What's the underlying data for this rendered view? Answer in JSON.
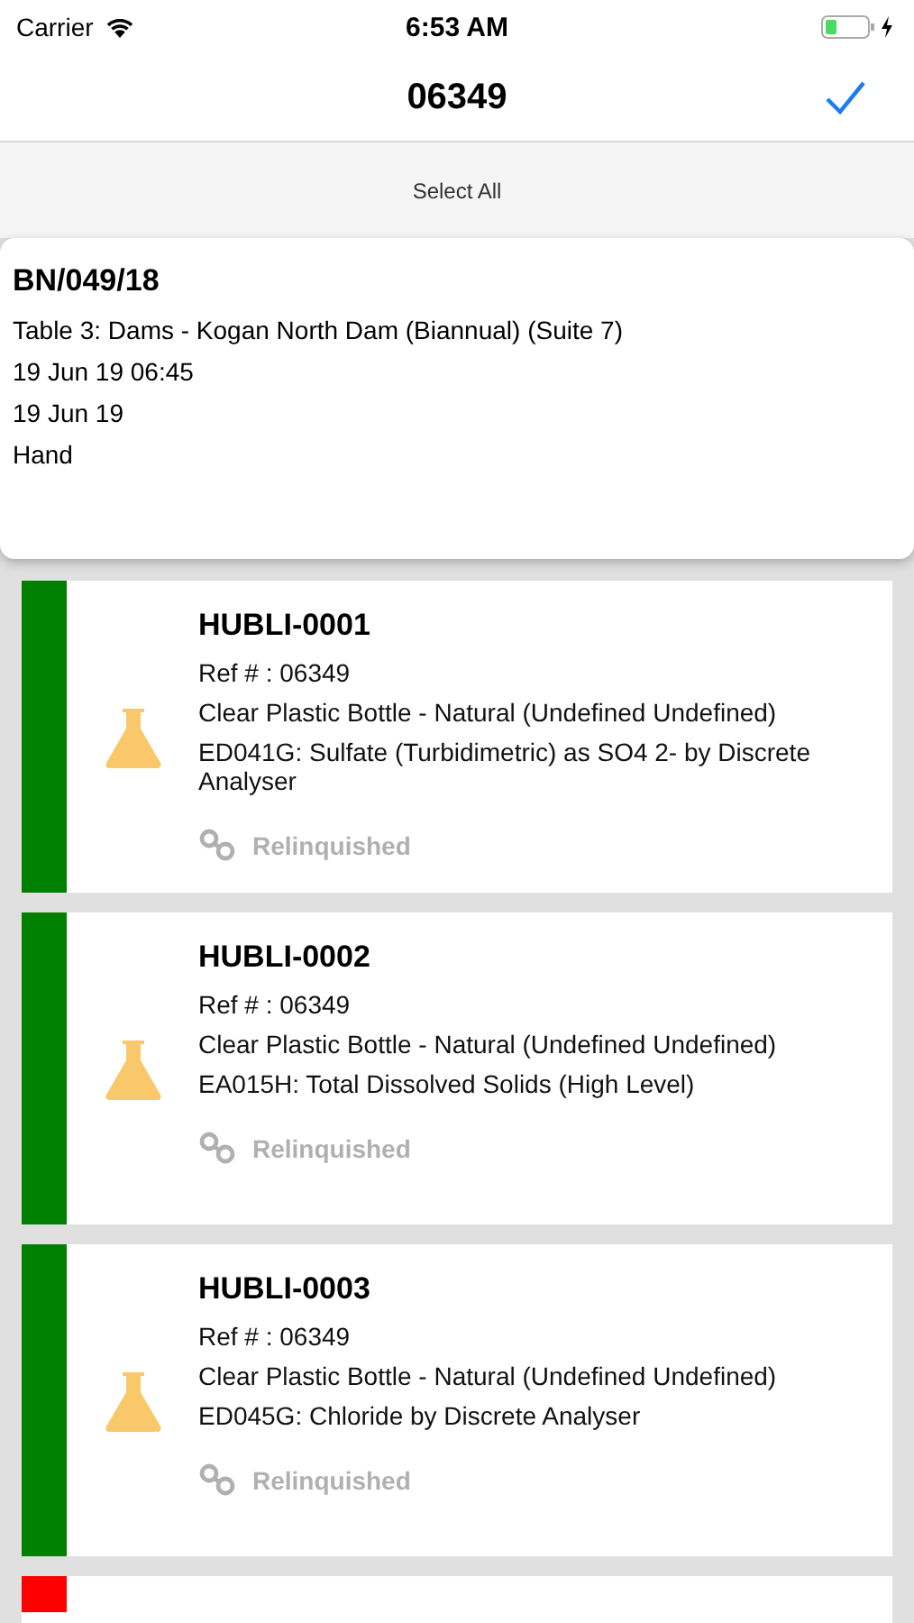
{
  "status_bar": {
    "carrier": "Carrier",
    "time": "6:53 AM"
  },
  "nav": {
    "title": "06349"
  },
  "select_all": "Select All",
  "header": {
    "batch": "BN/049/18",
    "lines": [
      "Table 3: Dams - Kogan North Dam (Biannual) (Suite 7)",
      "19 Jun 19 06:45",
      "19 Jun 19",
      "Hand"
    ]
  },
  "samples": [
    {
      "id": "HUBLI-0001",
      "ref": "Ref # : 06349",
      "container": "Clear Plastic Bottle - Natural (Undefined Undefined)",
      "test": "ED041G: Sulfate (Turbidimetric) as SO4 2- by Discrete Analyser",
      "status": "Relinquished",
      "color": "#008000"
    },
    {
      "id": "HUBLI-0002",
      "ref": "Ref # : 06349",
      "container": "Clear Plastic Bottle - Natural (Undefined Undefined)",
      "test": "EA015H: Total Dissolved Solids (High Level)",
      "status": "Relinquished",
      "color": "#008000"
    },
    {
      "id": "HUBLI-0003",
      "ref": "Ref # : 06349",
      "container": "Clear Plastic Bottle - Natural (Undefined Undefined)",
      "test": "ED045G: Chloride by Discrete Analyser",
      "status": "Relinquished",
      "color": "#008000"
    },
    {
      "color": "#ff0000"
    }
  ]
}
